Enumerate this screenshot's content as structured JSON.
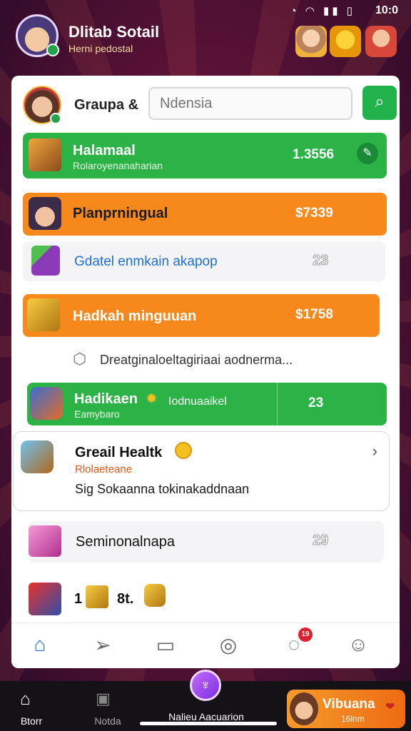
{
  "status": {
    "time": "10:0",
    "icons": "◔ ◠ ▮▮ ▯"
  },
  "header": {
    "title": "Dlitab Sotail",
    "subtitle": "Herni pedostal"
  },
  "search": {
    "user_label": "Graupa &",
    "placeholder": "Ndensia"
  },
  "rows": [
    {
      "title": "Halamaal",
      "subtitle": "Rolaroyenanaharian",
      "value": "1.3556",
      "icon": "crate-icon"
    },
    {
      "title": "Planprningual",
      "value": "$7339",
      "icon": "avatar-icon"
    },
    {
      "title": "Gdatel enmkain akapop",
      "value": "23",
      "icon": "gift-box-icon"
    },
    {
      "title": "Hadkah minguuan",
      "value": "$1758",
      "icon": "treasure-chest-icon"
    },
    {
      "text": "Dreatginaloeltagiriaai aodnerma..."
    },
    {
      "title": "Hadikaen",
      "tag": "Iodnuaaikel",
      "subtitle": "Eamybaro",
      "value": "23",
      "icon": "rocket-icon"
    },
    {
      "title": "Greail Healtk",
      "subtitle": "Rlolaeteane",
      "detail": "Sig Sokaanna tokinakaddnaan",
      "icon": "basket-icon"
    },
    {
      "title": "Seminonalnapa",
      "value": "29",
      "icon": "pink-chest-icon"
    },
    {
      "left": "1",
      "right": "8t.",
      "icon": "red-chest-icon"
    }
  ],
  "bottom": {
    "left_label": "Btorr",
    "mid_label": "Notda",
    "center_label": "Nalieu Aacuarion",
    "promo_title": "Vibuana",
    "promo_sub": "16lnm"
  },
  "nav": {
    "badge": "19"
  },
  "colors": {
    "green": "#2bb345",
    "orange": "#f7891c",
    "accent_blue": "#1e6fd9"
  }
}
